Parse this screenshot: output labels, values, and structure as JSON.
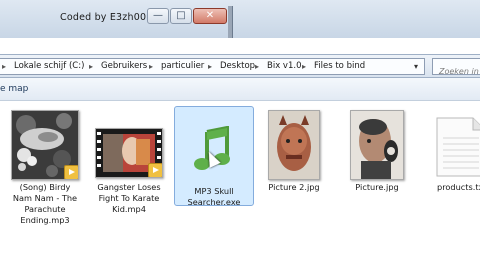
{
  "window": {
    "title": "Coded by E3zh00rn",
    "minimize_glyph": "—",
    "maximize_glyph": "□",
    "close_glyph": "✕"
  },
  "address_bar": {
    "breadcrumbs": [
      "Lokale schijf (C:)",
      "Gebruikers",
      "particulier",
      "Desktop",
      "Bix v1.0",
      "Files to bind"
    ],
    "separator_glyph": "▸",
    "dropdown_glyph": "▾",
    "search_placeholder": "Zoeken in"
  },
  "toolbar": {
    "organize_partial": "e map"
  },
  "files": [
    {
      "lines": [
        "(Song) Birdy",
        "Nam Nam - The",
        "Parachute",
        "Ending.mp3"
      ],
      "icon": "album-art-thumbnail",
      "badge": "play-icon"
    },
    {
      "lines": [
        "Gangster Loses",
        "Fight To Karate",
        "Kid.mp4"
      ],
      "icon": "video-thumbnail",
      "badge": "play-icon"
    },
    {
      "lines": [
        "MP3 Skull",
        "Searcher.exe"
      ],
      "icon": "music-note-icon",
      "selected": true
    },
    {
      "lines": [
        "Picture 2.jpg"
      ],
      "icon": "photo-thumbnail"
    },
    {
      "lines": [
        "Picture.jpg"
      ],
      "icon": "photo-thumbnail"
    },
    {
      "lines": [
        "products.tx"
      ],
      "icon": "text-file-icon"
    }
  ],
  "colors": {
    "selection": "#cce8ff",
    "selection_border": "#84acdd",
    "music_note": "#5fb04a"
  }
}
